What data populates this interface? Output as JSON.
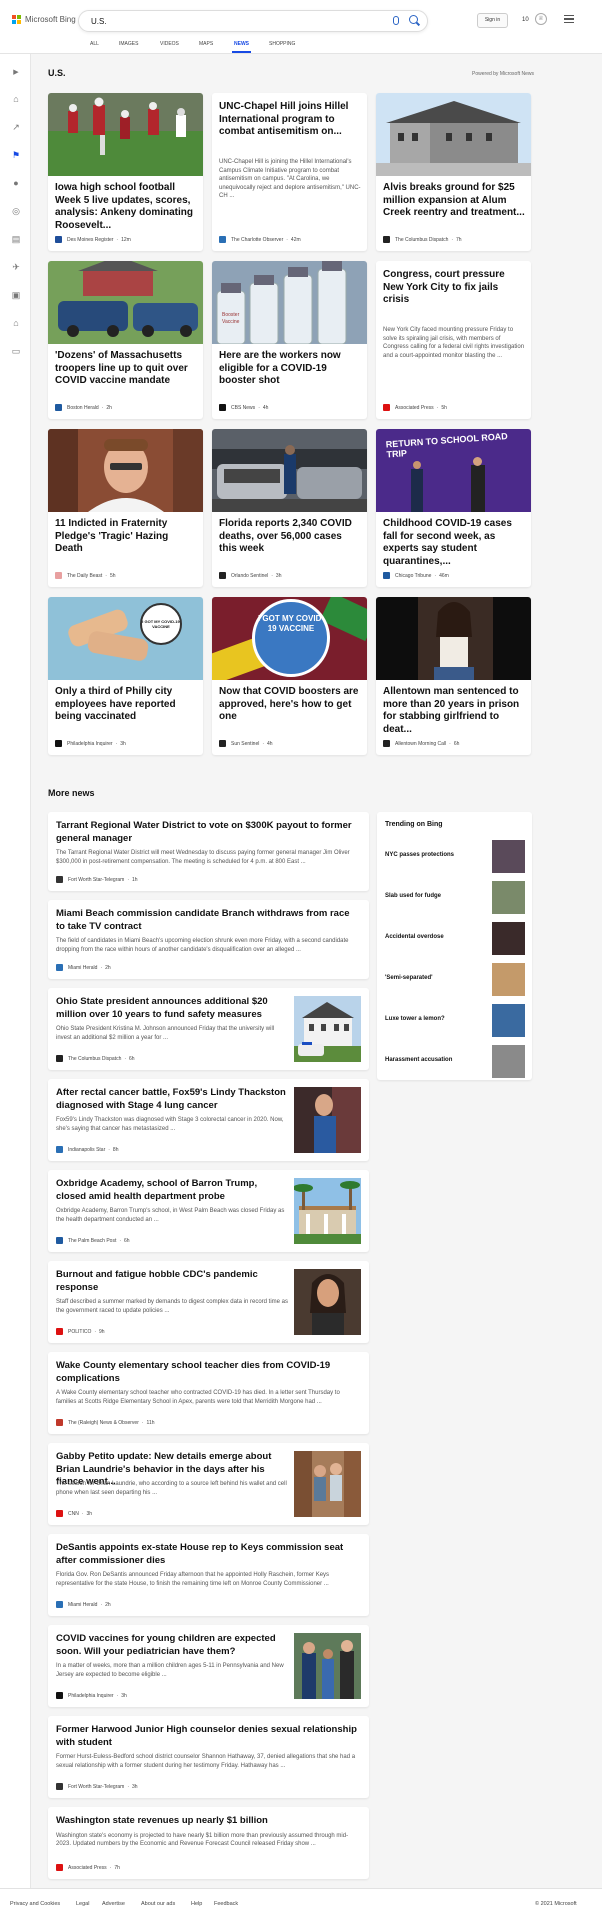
{
  "header": {
    "brand": "Microsoft Bing",
    "query": "U.S.",
    "signin": "Sign in",
    "rewards": "10"
  },
  "tabs": [
    "ALL",
    "IMAGES",
    "VIDEOS",
    "MAPS",
    "NEWS",
    "SHOPPING"
  ],
  "section": {
    "title": "U.S.",
    "powered": "Powered by Microsoft News"
  },
  "cards": [
    {
      "title": "Iowa high school football Week 5 live updates, scores, analysis: Ankeny dominating Roosevelt...",
      "source": "Des Moines Register",
      "time": "12m",
      "fav": "#1f4e9a",
      "img": "football"
    },
    {
      "title": "UNC-Chapel Hill joins Hillel International program to combat antisemitism on...",
      "snippet": "UNC-Chapel Hill is joining the Hillel International's Campus Climate Initiative program to combat antisemitism on campus. \"At Carolina, we unequivocally reject and deplore antisemitism,\" UNC-CH ...",
      "source": "The Charlotte Observer",
      "time": "42m",
      "fav": "#2a6fb5"
    },
    {
      "title": "Alvis breaks ground for $25 million expansion at Alum Creek reentry and treatment...",
      "source": "The Columbus Dispatch",
      "time": "7h",
      "fav": "#222",
      "img": "building"
    },
    {
      "title": "'Dozens' of Massachusetts troopers line up to quit over COVID vaccine mandate",
      "source": "Boston Herald",
      "time": "2h",
      "fav": "#1f5aa0",
      "img": "troopers"
    },
    {
      "title": "Here are the workers now eligible for a COVID-19 booster shot",
      "source": "CBS News",
      "time": "4h",
      "fav": "#111",
      "img": "vials"
    },
    {
      "title": "Congress, court pressure New York City to fix jails crisis",
      "snippet": "New York City faced mounting pressure Friday to solve its spiraling jail crisis, with members of Congress calling for a federal civil rights investigation and a court-appointed monitor blasting the ...",
      "source": "Associated Press",
      "time": "5h",
      "fav": "#d11"
    },
    {
      "title": "11 Indicted in Fraternity Pledge's 'Tragic' Hazing Death",
      "source": "The Daily Beast",
      "time": "5h",
      "fav": "#e8a0a0",
      "img": "portrait"
    },
    {
      "title": "Florida reports 2,340 COVID deaths, over 56,000 cases this week",
      "source": "Orlando Sentinel",
      "time": "3h",
      "fav": "#222",
      "img": "cars"
    },
    {
      "title": "Childhood COVID-19 cases fall for second week, as experts say student quarantines,...",
      "source": "Chicago Tribune",
      "time": "46m",
      "fav": "#1f5aa0",
      "img": "bus",
      "img_text": "RETURN TO SCHOOL ROAD TRIP"
    },
    {
      "title": "Only a third of Philly city employees have reported being vaccinated",
      "source": "Philadelphia Inquirer",
      "time": "3h",
      "fav": "#111",
      "img": "bandaid",
      "img_text": "I GOT MY COVID-19 VACCINE"
    },
    {
      "title": "Now that COVID boosters are approved, here's how to get one",
      "source": "Sun Sentinel",
      "time": "4h",
      "fav": "#222",
      "img": "badge",
      "img_text": "I GOT MY COVID-19 VACCINE"
    },
    {
      "title": "Allentown man sentenced to more than 20 years in prison for stabbing girlfriend to deat...",
      "source": "Allentown Morning Call",
      "time": "6h",
      "fav": "#222",
      "img": "woman"
    }
  ],
  "more": {
    "title": "More news",
    "items": [
      {
        "title": "Tarrant Regional Water District to vote on $300K payout to former general manager",
        "snippet": "The Tarrant Regional Water District will meet Wednesday to discuss paying former general manager Jim Oliver $300,000 in post-retirement compensation. The meeting is scheduled for 4 p.m. at 800 East ...",
        "source": "Fort Worth Star-Telegram",
        "time": "1h",
        "fav": "#333"
      },
      {
        "title": "Miami Beach commission candidate Branch withdraws from race to take TV contract",
        "snippet": "The field of candidates in Miami Beach's upcoming election shrunk even more Friday, with a second candidate dropping from the race within hours of another candidate's disqualification over an alleged ...",
        "source": "Miami Herald",
        "time": "2h",
        "fav": "#2a6fb5"
      },
      {
        "title": "Ohio State president announces additional $20 million over 10 years to fund safety measures",
        "snippet": "Ohio State President Kristina M. Johnson announced Friday that the university will invest an additional $2 million a year for ...",
        "source": "The Columbus Dispatch",
        "time": "6h",
        "fav": "#222",
        "thumb": "house"
      },
      {
        "title": "After rectal cancer battle, Fox59's Lindy Thackston diagnosed with Stage 4 lung cancer",
        "snippet": "Fox59's Lindy Thackston was diagnosed with Stage 3 colorectal cancer in 2020. Now, she's saying that cancer has metastasized ...",
        "source": "Indianapolis Star",
        "time": "8h",
        "fav": "#2a6fb5",
        "thumb": "man"
      },
      {
        "title": "Oxbridge Academy, school of Barron Trump, closed amid health department probe",
        "snippet": "Oxbridge Academy, Barron Trump's school, in West Palm Beach was closed Friday as the health department conducted an ...",
        "source": "The Palm Beach Post",
        "time": "6h",
        "fav": "#1f5aa0",
        "thumb": "palm"
      },
      {
        "title": "Burnout and fatigue hobble CDC's pandemic response",
        "snippet": "Staff described a summer marked by demands to digest complex data in record time as the government raced to update policies ...",
        "source": "POLITICO",
        "time": "9h",
        "fav": "#d11",
        "thumb": "woman2"
      },
      {
        "title": "Wake County elementary school teacher dies from COVID-19 complications",
        "snippet": "A Wake County elementary school teacher who contracted COVID-19 has died. In a letter sent Thursday to families at Scotts Ridge Elementary School in Apex, parents were told that Merridith Morgone had ...",
        "source": "The (Raleigh) News & Observer",
        "time": "11h",
        "fav": "#c0392b"
      },
      {
        "title": "Gabby Petito update: New details emerge about Brian Laundrie's behavior in the days after his fiance went...",
        "snippet": "The search for Brian Laundrie, who according to a source left behind his wallet and cell phone when last seen departing his ...",
        "source": "CNN",
        "time": "3h",
        "fav": "#d11",
        "thumb": "couple"
      },
      {
        "title": "DeSantis appoints ex-state House rep to Keys commission seat after commissioner dies",
        "snippet": "Florida Gov. Ron DeSantis announced Friday afternoon that he appointed Holly Raschein, former Keys representative for the state House, to finish the remaining time left on Monroe County Commissioner ...",
        "source": "Miami Herald",
        "time": "2h",
        "fav": "#2a6fb5"
      },
      {
        "title": "COVID vaccines for young children are expected soon. Will your pediatrician have them?",
        "snippet": "In a matter of weeks, more than a million children ages 5-11 in Pennsylvania and New Jersey are expected to become eligible ...",
        "source": "Philadelphia Inquirer",
        "time": "3h",
        "fav": "#111",
        "thumb": "kids"
      },
      {
        "title": "Former Harwood Junior High counselor denies sexual relationship with student",
        "snippet": "Former Hurst-Euless-Bedford school district counselor Shannon Hathaway, 37, denied allegations that she had a sexual relationship with a former student during her testimony Friday. Hathaway has ...",
        "source": "Fort Worth Star-Telegram",
        "time": "3h",
        "fav": "#333"
      },
      {
        "title": "Washington state revenues up nearly $1 billion",
        "snippet": "Washington state's economy is projected to have nearly $1 billion more than previously assumed through mid-2023. Updated numbers by the Economic and Revenue Forecast Council released Friday show ...",
        "source": "Associated Press",
        "time": "7h",
        "fav": "#d11"
      }
    ]
  },
  "trending": {
    "title": "Trending on Bing",
    "items": [
      "NYC passes protections",
      "Slab used for fudge",
      "Accidental overdose",
      "'Semi-separated'",
      "Luxe tower a lemon?",
      "Harassment accusation"
    ]
  },
  "footer": {
    "links": [
      "Privacy and Cookies",
      "Legal",
      "Advertise",
      "About our ads",
      "Help",
      "Feedback"
    ],
    "copyright": "© 2021 Microsoft"
  }
}
